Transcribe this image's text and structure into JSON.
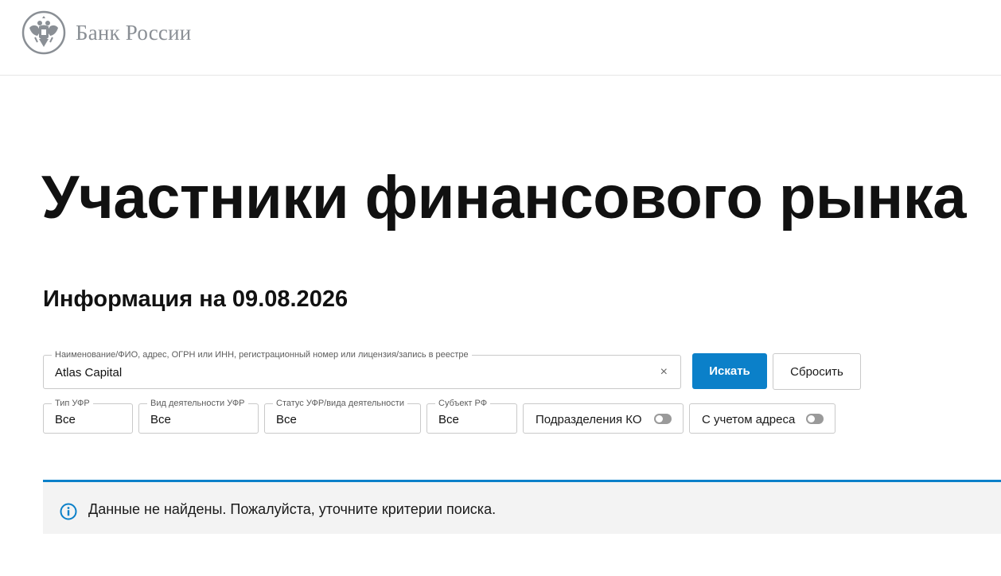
{
  "header": {
    "logo_text": "Банк России"
  },
  "main": {
    "title": "Участники финансового рынка",
    "info_date": "Информация на 09.08.2026"
  },
  "search": {
    "label": "Наименование/ФИО, адрес, ОГРН или ИНН, регистрационный номер или лицензия/запись в реестре",
    "value": "Atlas Capital",
    "clear_icon": "×",
    "search_button": "Искать",
    "reset_button": "Сбросить"
  },
  "filters": {
    "type": {
      "label": "Тип УФР",
      "value": "Все"
    },
    "activity": {
      "label": "Вид деятельности УФР",
      "value": "Все"
    },
    "status": {
      "label": "Статус УФР/вида деятельности",
      "value": "Все"
    },
    "region": {
      "label": "Субъект РФ",
      "value": "Все"
    },
    "divisions_toggle": {
      "label": "Подразделения КО",
      "checked": false
    },
    "address_toggle": {
      "label": "С учетом адреса",
      "checked": false
    }
  },
  "notice": {
    "icon": "info-icon",
    "text": "Данные не найдены. Пожалуйста, уточните критерии поиска."
  },
  "colors": {
    "accent": "#0b80c9",
    "logo_gray": "#8a8f95",
    "notice_bg": "#f3f3f3"
  }
}
